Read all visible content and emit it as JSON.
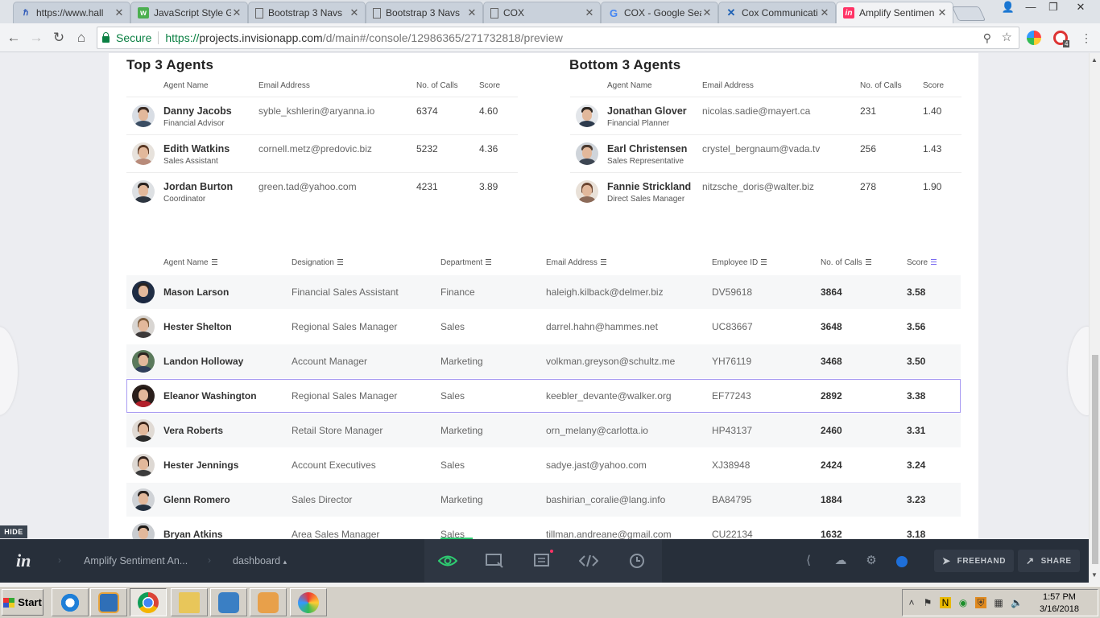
{
  "browser": {
    "tabs": [
      {
        "label": "https://www.hall",
        "icon": "hallmark-icon"
      },
      {
        "label": "JavaScript Style G",
        "icon": "w3schools-icon"
      },
      {
        "label": "Bootstrap 3 Navs",
        "icon": "page-icon"
      },
      {
        "label": "Bootstrap 3 Navs",
        "icon": "page-icon"
      },
      {
        "label": "COX",
        "icon": "page-icon"
      },
      {
        "label": "COX - Google Sea",
        "icon": "google-icon"
      },
      {
        "label": "Cox Communicati",
        "icon": "cox-icon"
      },
      {
        "label": "Amplify Sentimen",
        "icon": "invision-icon"
      }
    ],
    "secure_label": "Secure",
    "url_scheme": "https://",
    "url_host": "projects.invisionapp.com",
    "url_path": "/d/main#/console/12986365/271732818/preview",
    "ext_badge": "4"
  },
  "top_agents": {
    "title": "Top 3 Agents",
    "headers": {
      "name": "Agent Name",
      "email": "Email Address",
      "calls": "No. of Calls",
      "score": "Score"
    },
    "rows": [
      {
        "name": "Danny Jacobs",
        "role": "Financial Advisor",
        "email": "syble_kshlerin@aryanna.io",
        "calls": "6374",
        "score": "4.60"
      },
      {
        "name": "Edith Watkins",
        "role": "Sales Assistant",
        "email": "cornell.metz@predovic.biz",
        "calls": "5232",
        "score": "4.36"
      },
      {
        "name": "Jordan Burton",
        "role": "Coordinator",
        "email": "green.tad@yahoo.com",
        "calls": "4231",
        "score": "3.89"
      }
    ]
  },
  "bottom_agents": {
    "title": "Bottom 3 Agents",
    "headers": {
      "name": "Agent Name",
      "email": "Email Address",
      "calls": "No. of Calls",
      "score": "Score"
    },
    "rows": [
      {
        "name": "Jonathan Glover",
        "role": "Financial Planner",
        "email": "nicolas.sadie@mayert.ca",
        "calls": "231",
        "score": "1.40"
      },
      {
        "name": "Earl Christensen",
        "role": "Sales Representative",
        "email": "crystel_bergnaum@vada.tv",
        "calls": "256",
        "score": "1.43"
      },
      {
        "name": "Fannie Strickland",
        "role": "Direct Sales Manager",
        "email": "nitzsche_doris@walter.biz",
        "calls": "278",
        "score": "1.90"
      }
    ]
  },
  "agents_table": {
    "headers": {
      "name": "Agent Name",
      "designation": "Designation",
      "department": "Department",
      "email": "Email Address",
      "employee_id": "Employee ID",
      "calls": "No. of Calls",
      "score": "Score"
    },
    "sorted_by": "Score",
    "selected_row": 3,
    "rows": [
      {
        "name": "Mason Larson",
        "designation": "Financial Sales Assistant",
        "department": "Finance",
        "email": "haleigh.kilback@delmer.biz",
        "employee_id": "DV59618",
        "calls": "3864",
        "score": "3.58"
      },
      {
        "name": "Hester Shelton",
        "designation": "Regional Sales Manager",
        "department": "Sales",
        "email": "darrel.hahn@hammes.net",
        "employee_id": "UC83667",
        "calls": "3648",
        "score": "3.56"
      },
      {
        "name": "Landon Holloway",
        "designation": "Account Manager",
        "department": "Marketing",
        "email": "volkman.greyson@schultz.me",
        "employee_id": "YH76119",
        "calls": "3468",
        "score": "3.50"
      },
      {
        "name": "Eleanor Washington",
        "designation": "Regional Sales Manager",
        "department": "Sales",
        "email": "keebler_devante@walker.org",
        "employee_id": "EF77243",
        "calls": "2892",
        "score": "3.38"
      },
      {
        "name": "Vera Roberts",
        "designation": "Retail Store Manager",
        "department": "Marketing",
        "email": "orn_melany@carlotta.io",
        "employee_id": "HP43137",
        "calls": "2460",
        "score": "3.31"
      },
      {
        "name": "Hester Jennings",
        "designation": "Account Executives",
        "department": "Sales",
        "email": "sadye.jast@yahoo.com",
        "employee_id": "XJ38948",
        "calls": "2424",
        "score": "3.24"
      },
      {
        "name": "Glenn Romero",
        "designation": "Sales Director",
        "department": "Marketing",
        "email": "bashirian_coralie@lang.info",
        "employee_id": "BA84795",
        "calls": "1884",
        "score": "3.23"
      },
      {
        "name": "Bryan Atkins",
        "designation": "Area Sales Manager",
        "department": "Sales",
        "email": "tillman.andreane@gmail.com",
        "employee_id": "CU22134",
        "calls": "1632",
        "score": "3.18"
      }
    ]
  },
  "invision": {
    "hide_label": "HIDE",
    "project": "Amplify Sentiment An...",
    "screen": "dashboard",
    "freehand_label": "FREEHAND",
    "share_label": "SHARE"
  },
  "taskbar": {
    "start_label": "Start",
    "time": "1:57 PM",
    "date": "3/16/2018"
  },
  "colors": {
    "accent": "#7b6cf0",
    "active_mode": "#2ecc71",
    "invision_bar": "#272f3a",
    "secure": "#0b8043"
  }
}
